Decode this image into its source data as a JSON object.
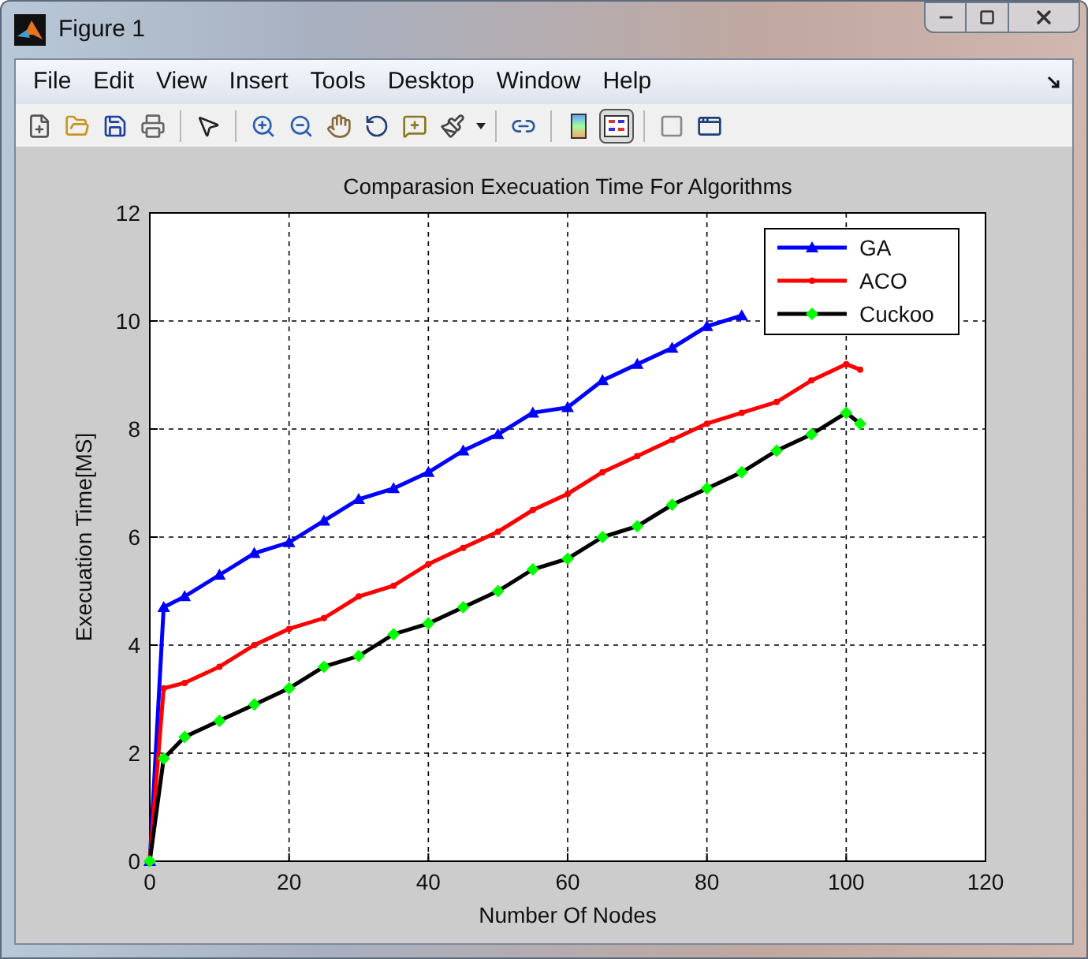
{
  "window": {
    "title": "Figure 1"
  },
  "menu": [
    "File",
    "Edit",
    "View",
    "Insert",
    "Tools",
    "Desktop",
    "Window",
    "Help"
  ],
  "toolbar": [
    {
      "kind": "new"
    },
    {
      "kind": "open"
    },
    {
      "kind": "save"
    },
    {
      "kind": "print"
    },
    {
      "kind": "sep"
    },
    {
      "kind": "pointer"
    },
    {
      "kind": "sep"
    },
    {
      "kind": "zoom_in"
    },
    {
      "kind": "zoom_out"
    },
    {
      "kind": "pan"
    },
    {
      "kind": "rotate"
    },
    {
      "kind": "cursor"
    },
    {
      "kind": "brush"
    },
    {
      "kind": "sep"
    },
    {
      "kind": "link"
    },
    {
      "kind": "sep"
    },
    {
      "kind": "colorbar",
      "selected": false
    },
    {
      "kind": "legend",
      "selected": true
    },
    {
      "kind": "sep"
    },
    {
      "kind": "hide"
    },
    {
      "kind": "show"
    }
  ],
  "figure": {
    "chart_data": {
      "type": "line",
      "title": "Comparasion Execuation Time For Algorithms",
      "xlabel": "Number Of Nodes",
      "ylabel": "Execuation Time[MS]",
      "x": [
        0,
        2,
        5,
        10,
        15,
        20,
        25,
        30,
        35,
        40,
        45,
        50,
        55,
        60,
        65,
        70,
        75,
        80,
        85,
        90,
        95,
        100,
        102
      ],
      "series": [
        {
          "name": "GA",
          "color": "#0000ff",
          "marker": "triangle",
          "values": [
            0,
            4.7,
            4.9,
            5.3,
            5.7,
            5.9,
            6.3,
            6.7,
            6.9,
            7.2,
            7.6,
            7.9,
            8.3,
            8.4,
            8.9,
            9.2,
            9.5,
            9.9,
            10.1,
            null,
            null,
            null,
            null
          ]
        },
        {
          "name": "ACO",
          "color": "#ff0000",
          "marker": "dot",
          "values": [
            0,
            3.2,
            3.3,
            3.6,
            4.0,
            4.3,
            4.5,
            4.9,
            5.1,
            5.5,
            5.8,
            6.1,
            6.5,
            6.8,
            7.2,
            7.5,
            7.8,
            8.1,
            8.3,
            8.5,
            8.9,
            9.2,
            9.1
          ]
        },
        {
          "name": "Cuckoo",
          "color": "#000000",
          "marker": "diamond",
          "values": [
            0,
            1.9,
            2.3,
            2.6,
            2.9,
            3.2,
            3.6,
            3.8,
            4.2,
            4.4,
            4.7,
            5.0,
            5.4,
            5.6,
            6.0,
            6.2,
            6.6,
            6.9,
            7.2,
            7.6,
            7.9,
            8.3,
            8.1
          ]
        }
      ],
      "grid": true,
      "legend": true,
      "xlim": [
        0,
        120
      ],
      "ylim": [
        0,
        12
      ],
      "xticks": [
        0,
        20,
        40,
        60,
        80,
        100,
        120
      ],
      "yticks": [
        0,
        2,
        4,
        6,
        8,
        10,
        12
      ]
    }
  }
}
